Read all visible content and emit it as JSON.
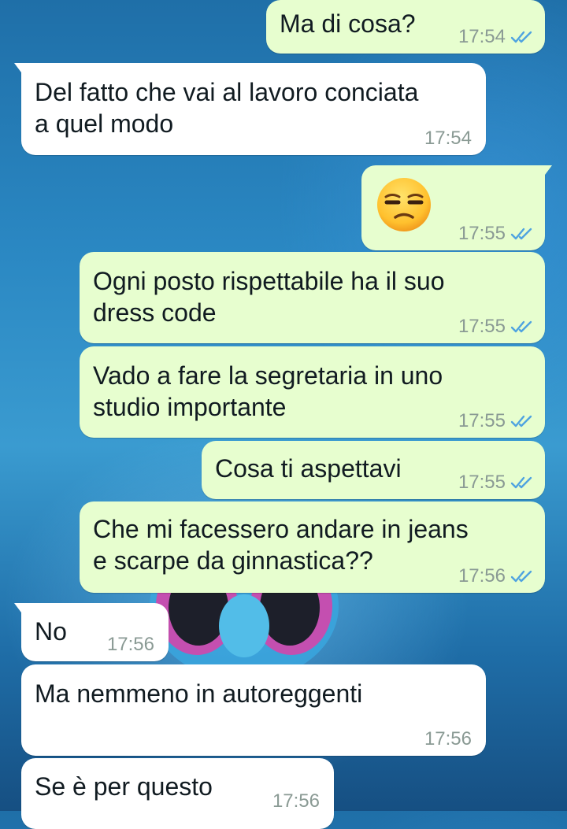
{
  "theme": {
    "outgoing_bubble": "#e7fecf",
    "incoming_bubble": "#ffffff",
    "read_tick_color": "#4fa3e0",
    "timestamp_color": "#8a9a94"
  },
  "messages": [
    {
      "direction": "outgoing",
      "text": "Ma di cosa?",
      "time": "17:54",
      "status": "read"
    },
    {
      "direction": "incoming",
      "text": "Del fatto che vai al lavoro conciata\na quel modo",
      "time": "17:54"
    },
    {
      "direction": "outgoing",
      "emoji": "unamused-face-emoji",
      "time": "17:55",
      "status": "read"
    },
    {
      "direction": "outgoing",
      "text": "Ogni posto rispettabile ha il suo\ndress code",
      "time": "17:55",
      "status": "read"
    },
    {
      "direction": "outgoing",
      "text": "Vado a fare la segretaria in uno\nstudio importante",
      "time": "17:55",
      "status": "read"
    },
    {
      "direction": "outgoing",
      "text": "Cosa ti aspettavi",
      "time": "17:55",
      "status": "read"
    },
    {
      "direction": "outgoing",
      "text": "Che mi facessero andare in jeans\ne scarpe da ginnastica??",
      "time": "17:56",
      "status": "read"
    },
    {
      "direction": "incoming",
      "text": "No",
      "time": "17:56"
    },
    {
      "direction": "incoming",
      "text": "Ma nemmeno in autoreggenti",
      "time": "17:56"
    },
    {
      "direction": "incoming",
      "text": "Se è per questo",
      "time": "17:56"
    }
  ]
}
